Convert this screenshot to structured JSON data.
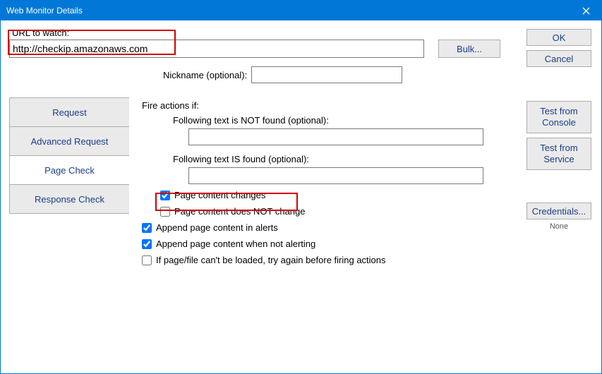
{
  "title": "Web Monitor Details",
  "url": {
    "label": "URL to watch:",
    "value": "http://checkip.amazonaws.com"
  },
  "bulk_label": "Bulk...",
  "nickname": {
    "label": "Nickname (optional):",
    "value": ""
  },
  "right_buttons": {
    "ok": "OK",
    "cancel": "Cancel",
    "test_console": "Test from Console",
    "test_service": "Test from Service",
    "credentials": "Credentials...",
    "credentials_sub": "None"
  },
  "tabs": {
    "request": "Request",
    "advanced": "Advanced Request",
    "page_check": "Page Check",
    "response_check": "Response Check"
  },
  "pane": {
    "header": "Fire actions if:",
    "not_found_label": "Following text is NOT found (optional):",
    "not_found_value": "",
    "is_found_label": "Following text IS found (optional):",
    "is_found_value": "",
    "chk_changes": "Page content changes",
    "chk_no_change": "Page content does NOT change",
    "chk_append_alerts": "Append page content in alerts",
    "chk_append_not_alerting": "Append page content when not alerting",
    "chk_retry": "If page/file can't be loaded, try again before firing actions"
  }
}
